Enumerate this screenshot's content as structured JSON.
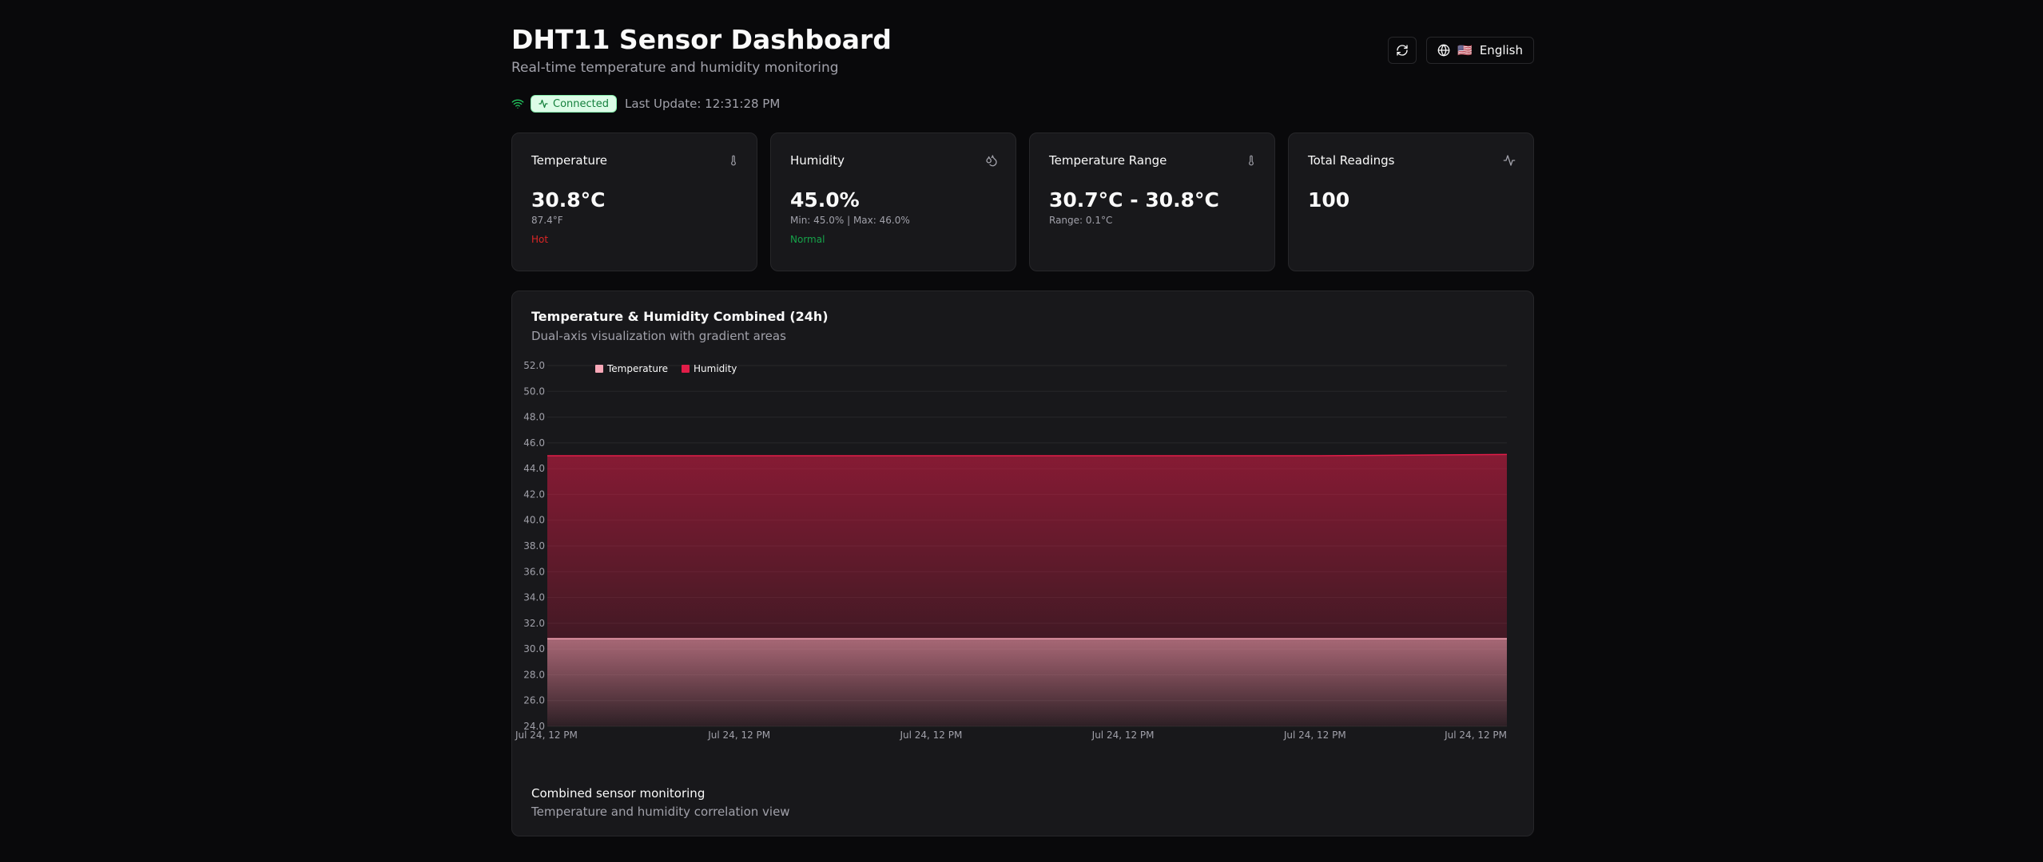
{
  "header": {
    "title": "DHT11 Sensor Dashboard",
    "subtitle": "Real-time temperature and humidity monitoring",
    "language_label": "English",
    "language_flag": "🇺🇸"
  },
  "status": {
    "badge": "Connected",
    "last_update": "Last Update: 12:31:28 PM"
  },
  "cards": [
    {
      "title": "Temperature",
      "icon": "thermometer-icon",
      "value": "30.8°C",
      "sub": "87.4°F",
      "status": "Hot",
      "status_color": "#dc2626"
    },
    {
      "title": "Humidity",
      "icon": "droplets-icon",
      "value": "45.0%",
      "sub": "Min: 45.0% | Max: 46.0%",
      "status": "Normal",
      "status_color": "#16a34a"
    },
    {
      "title": "Temperature Range",
      "icon": "thermometer-icon",
      "value": "30.7°C - 30.8°C",
      "sub": "Range: 0.1°C",
      "status": "",
      "status_color": ""
    },
    {
      "title": "Total Readings",
      "icon": "activity-icon",
      "value": "100",
      "sub": "",
      "status": "",
      "status_color": ""
    }
  ],
  "chart": {
    "title": "Temperature & Humidity Combined (24h)",
    "subtitle": "Dual-axis visualization with gradient areas",
    "footer_title": "Combined sensor monitoring",
    "footer_sub": "Temperature and humidity correlation view"
  },
  "colors": {
    "background": "#09090b",
    "card": "#18181b",
    "border": "#27272a",
    "connected": "#22c55e",
    "temperature": "#f9a8b8",
    "humidity": "#e11d48"
  },
  "chart_data": {
    "type": "area",
    "x": [
      "Jul 24, 12 PM",
      "Jul 24, 12 PM",
      "Jul 24, 12 PM",
      "Jul 24, 12 PM",
      "Jul 24, 12 PM",
      "Jul 24, 12 PM"
    ],
    "series": [
      {
        "name": "Temperature",
        "values": [
          30.8,
          30.8,
          30.8,
          30.8,
          30.8,
          30.8
        ]
      },
      {
        "name": "Humidity",
        "values": [
          45.0,
          45.0,
          45.0,
          45.0,
          45.0,
          45.1
        ]
      }
    ],
    "ylim": [
      24,
      52
    ],
    "yticks": [
      "24.0",
      "26.0",
      "28.0",
      "30.0",
      "32.0",
      "34.0",
      "36.0",
      "38.0",
      "40.0",
      "42.0",
      "44.0",
      "46.0",
      "48.0",
      "50.0",
      "52.0"
    ],
    "xticks": [
      "Jul 24, 12 PM",
      "Jul 24, 12 PM",
      "Jul 24, 12 PM",
      "Jul 24, 12 PM",
      "Jul 24, 12 PM",
      "Jul 24, 12 PM"
    ],
    "legend": "top-left",
    "grid": true
  }
}
